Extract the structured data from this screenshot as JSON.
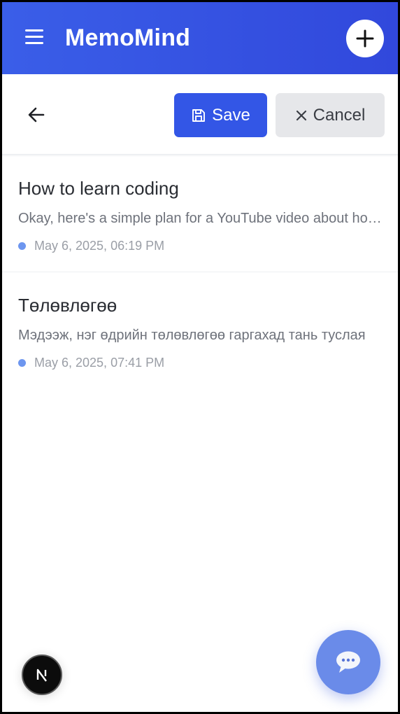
{
  "header": {
    "title": "MemoMind",
    "menu_icon": "hamburger-menu-icon",
    "add_icon": "plus-icon"
  },
  "toolbar": {
    "back_icon": "arrow-left-icon",
    "save_label": "Save",
    "save_icon": "floppy-disk-icon",
    "cancel_label": "Cancel",
    "cancel_icon": "close-icon"
  },
  "notes": [
    {
      "title": "How to learn coding",
      "preview": "Okay, here's a simple plan for a YouTube video about how to learn coding",
      "date": "May 6, 2025, 06:19 PM"
    },
    {
      "title": "Төлөвлөгөө",
      "preview": "Мэдээж, нэг өдрийн төлөвлөгөө гаргахад тань туслая",
      "date": "May 6, 2025, 07:41 PM"
    }
  ],
  "floating": {
    "next_badge_letter": "N",
    "chat_icon": "chat-bubble-icon"
  },
  "colors": {
    "brand": "#3356e6",
    "header_gradient_start": "#3a5ee8",
    "header_gradient_end": "#3148dc",
    "date_dot": "#6d96ef",
    "chat_fab": "#6a8be9"
  }
}
